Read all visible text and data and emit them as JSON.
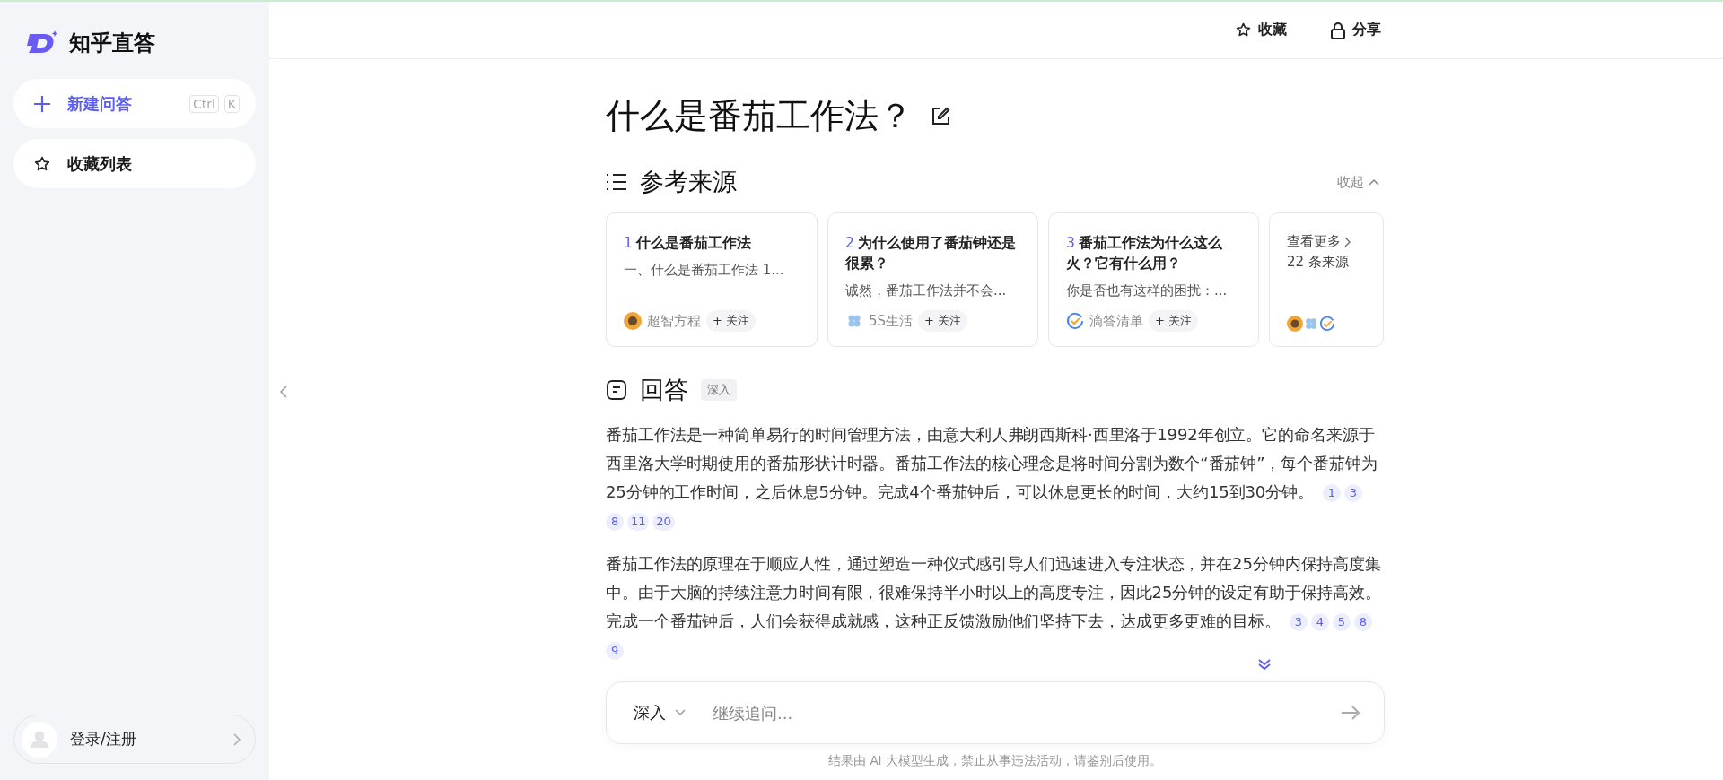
{
  "sidebar": {
    "logo": "知乎直答",
    "new_chat": {
      "label": "新建问答",
      "shortcut": [
        "Ctrl",
        "K"
      ]
    },
    "items": [
      {
        "label": "收藏列表"
      }
    ],
    "login": "登录/注册"
  },
  "topbar": {
    "actions": [
      {
        "kind": "star",
        "label": "收藏"
      },
      {
        "kind": "lock",
        "label": "分享"
      }
    ]
  },
  "question": "什么是番茄工作法？",
  "sources": {
    "title": "参考来源",
    "collapse": "收起",
    "cards": [
      {
        "index": "1",
        "title": "什么是番茄工作法",
        "snippet": "一、什么是番茄工作法 1...",
        "author": "超智方程",
        "follow": "+ 关注"
      },
      {
        "index": "2",
        "title": "为什么使用了番茄钟还是很累？",
        "snippet": "诚然，番茄工作法并不会...",
        "author": "5S生活",
        "follow": "+ 关注"
      },
      {
        "index": "3",
        "title": "番茄工作法为什么这么火？它有什么用？",
        "snippet": "你是否也有这样的困扰：...",
        "author": "滴答清单",
        "follow": "+ 关注"
      }
    ],
    "more": {
      "label": "查看更多",
      "count": "22 条来源"
    }
  },
  "answer": {
    "title": "回答",
    "badge": "深入",
    "paragraphs": [
      {
        "text": "番茄工作法是一种简单易行的时间管理方法，由意大利人弗朗西斯科·西里洛于1992年创立。它的命名来源于西里洛大学时期使用的番茄形状计时器。番茄工作法的核心理念是将时间分割为数个“番茄钟”，每个番茄钟为25分钟的工作时间，之后休息5分钟。完成4个番茄钟后，可以休息更长的时间，大约15到30分钟。",
        "refs": [
          "1",
          "3",
          "8",
          "11",
          "20"
        ]
      },
      {
        "text": "番茄工作法的原理在于顺应人性，通过塑造一种仪式感引导人们迅速进入专注状态，并在25分钟内保持高度集中。由于大脑的持续注意力时间有限，很难保持半小时以上的高度专注，因此25分钟的设定有助于保持高效。完成一个番茄钟后，人们会获得成就感，这种正反馈激励他们坚持下去，达成更多更难的目标。",
        "refs": [
          "3",
          "4",
          "5",
          "8",
          "9"
        ]
      }
    ]
  },
  "composer": {
    "mode": "深入",
    "placeholder": "继续追问..."
  },
  "disclaimer": "结果由 AI 大模型生成，禁止从事违法活动，请鉴别后使用。"
}
